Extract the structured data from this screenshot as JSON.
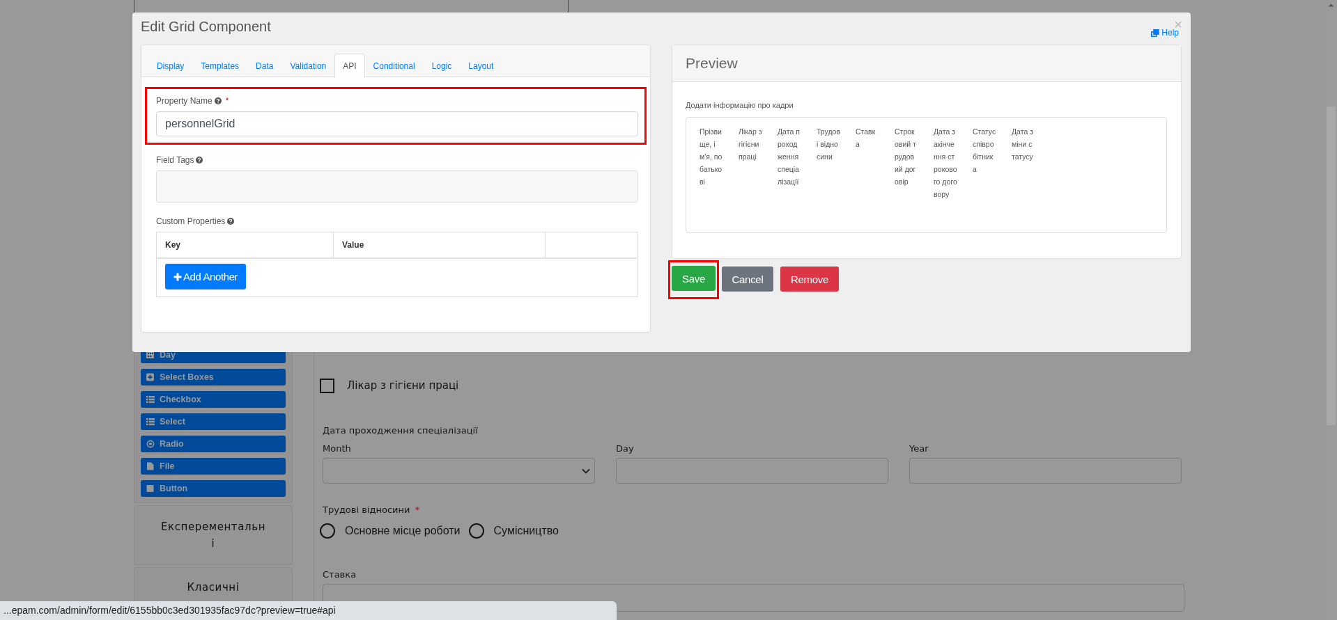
{
  "sidebar": {
    "components": [
      {
        "label": "Day",
        "kind": "day"
      },
      {
        "label": "Select Boxes",
        "kind": "select_boxes"
      },
      {
        "label": "Checkbox",
        "kind": "checkbox"
      },
      {
        "label": "Select",
        "kind": "select"
      },
      {
        "label": "Radio",
        "kind": "radio"
      },
      {
        "label": "File",
        "kind": "file"
      },
      {
        "label": "Button",
        "kind": "button"
      }
    ],
    "groups": [
      {
        "label": "Експерементальні"
      },
      {
        "label": "Класичні"
      }
    ]
  },
  "form": {
    "fields": [
      {
        "kind": "checkbox",
        "label": "Лікар з гігієни праці",
        "checked": false
      },
      {
        "kind": "date",
        "label": "Дата проходження спеціалізації",
        "parts": [
          {
            "label": "Month",
            "kind": "select"
          },
          {
            "label": "Day",
            "kind": "text"
          },
          {
            "label": "Year",
            "kind": "text"
          }
        ]
      },
      {
        "kind": "radio",
        "label": "Трудові відносини",
        "required_mark": "*",
        "options": [
          {
            "label": "Основне місце роботи",
            "selected": false
          },
          {
            "label": "Сумісництво",
            "selected": false
          }
        ]
      },
      {
        "kind": "text",
        "label": "Ставка"
      }
    ]
  },
  "dialog": {
    "title": "Edit Grid Component",
    "close": "×",
    "help": "Help",
    "tabs": [
      {
        "label": "Display",
        "selected": false
      },
      {
        "label": "Templates",
        "selected": false
      },
      {
        "label": "Data",
        "selected": false
      },
      {
        "label": "Validation",
        "selected": false
      },
      {
        "label": "API",
        "selected": true
      },
      {
        "label": "Conditional",
        "selected": false
      },
      {
        "label": "Logic",
        "selected": false
      },
      {
        "label": "Layout",
        "selected": false
      }
    ],
    "property_name": {
      "label": "Property Name",
      "required_mark": "*",
      "value": "personnelGrid",
      "highlighted": true
    },
    "field_tags": {
      "label": "Field Tags"
    },
    "custom_properties": {
      "label": "Custom Properties",
      "columns": [
        "Key",
        "Value"
      ],
      "add_button": "Add Another"
    },
    "preview": {
      "title": "Preview",
      "grid_label": "Додати інформацію про кадри",
      "columns": [
        "Прізвище, ім'я, по батькові",
        "Лікар з гігієни праці",
        "Дата проходження спеціалізації",
        "Трудові відносини",
        "Ставка",
        "Строковий трудовий договір",
        "Дата закінчення строкового договору",
        "Статус співробітника",
        "Дата зміни статусу"
      ]
    },
    "buttons": [
      {
        "label": "Save",
        "kind": "success",
        "highlighted": true
      },
      {
        "label": "Cancel",
        "kind": "secondary",
        "highlighted": false
      },
      {
        "label": "Remove",
        "kind": "danger",
        "highlighted": false
      }
    ]
  },
  "status_bar": {
    "url": "...epam.com/admin/form/edit/6155bb0c3ed301935fac97dc?preview=true#api"
  }
}
